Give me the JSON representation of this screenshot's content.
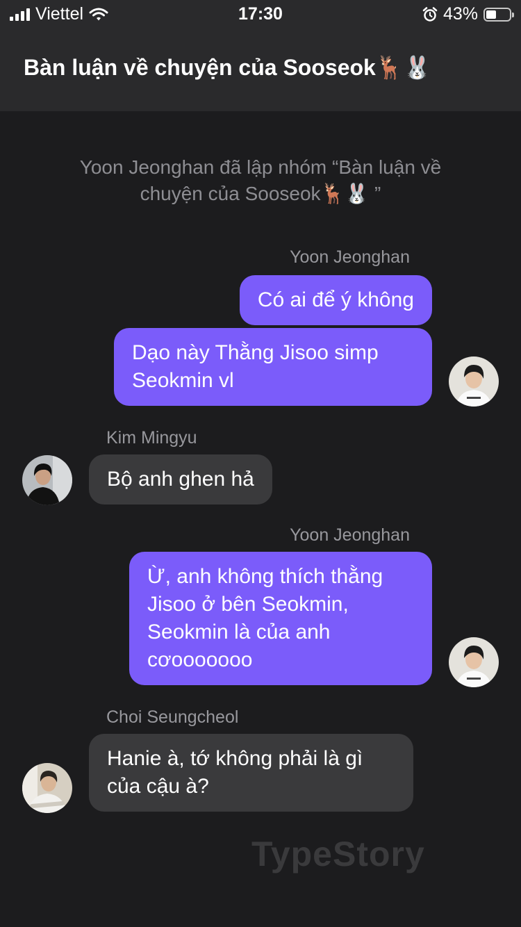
{
  "status_bar": {
    "carrier": "Viettel",
    "time": "17:30",
    "battery_percent": "43%",
    "battery_level": 0.43
  },
  "header": {
    "title": "Bàn luận về chuyện của Sooseok🦌🐰"
  },
  "chat": {
    "system_message": "Yoon Jeonghan đã lập nhóm “Bàn luận về chuyện của Sooseok🦌🐰 ”",
    "groups": [
      {
        "sender": "Yoon Jeonghan",
        "direction": "out",
        "messages": [
          "Có ai để ý không",
          "Dạo này Thằng Jisoo simp Seokmin vl"
        ]
      },
      {
        "sender": "Kim Mingyu",
        "direction": "in",
        "messages": [
          "Bộ anh ghen hả"
        ]
      },
      {
        "sender": "Yoon Jeonghan",
        "direction": "out",
        "messages": [
          "Ừ, anh không thích thằng Jisoo ở bên Seokmin, Seokmin là của anh cơooooooo"
        ]
      },
      {
        "sender": "Choi Seungcheol",
        "direction": "in",
        "messages": [
          "Hanie à, tớ không phải là gì của cậu à?"
        ]
      }
    ]
  },
  "watermark": "TypeStory",
  "colors": {
    "background": "#1c1c1e",
    "header_background": "#2a2a2c",
    "outgoing_bubble": "#7b5cfa",
    "incoming_bubble": "#3a3a3c",
    "name_text": "#98989d",
    "system_text": "#8e8e93"
  }
}
